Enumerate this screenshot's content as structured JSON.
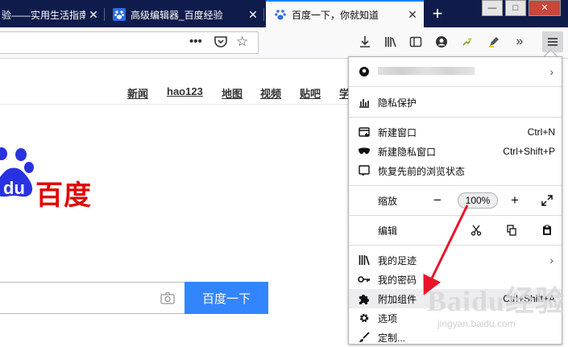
{
  "tabs": [
    {
      "title": "验——实用生活指南"
    },
    {
      "title": "高级编辑器_百度经验"
    },
    {
      "title": "百度一下，你就知道"
    }
  ],
  "window": {
    "minimize": "—",
    "maximize": "□",
    "close": "✕"
  },
  "newtab_label": "+",
  "page": {
    "topnav": [
      "新闻",
      "hao123",
      "地图",
      "视频",
      "贴吧",
      "学"
    ],
    "logo_text": "百度",
    "logo_mark": "du",
    "search_button": "百度一下"
  },
  "menu": {
    "account_row": "",
    "privacy": "隐私保护",
    "new_window": "新建窗口",
    "new_window_shortcut": "Ctrl+N",
    "new_private": "新建隐私窗口",
    "new_private_shortcut": "Ctrl+Shift+P",
    "restore": "恢复先前的浏览状态",
    "zoom_label": "缩放",
    "zoom_minus": "−",
    "zoom_value": "100%",
    "zoom_plus": "+",
    "edit_label": "编辑",
    "library": "我的足迹",
    "passwords": "我的密码",
    "addons": "附加组件",
    "addons_shortcut": "Ctrl+Shift+A",
    "options": "选项",
    "customize": "定制..."
  },
  "watermark": {
    "main": "Baidu经验",
    "sub": "jingyan.baidu.com"
  },
  "colors": {
    "accent": "#0a84ff",
    "baidu_red": "#e10601",
    "baidu_blue": "#3385ff",
    "arrow": "#e8142a"
  }
}
